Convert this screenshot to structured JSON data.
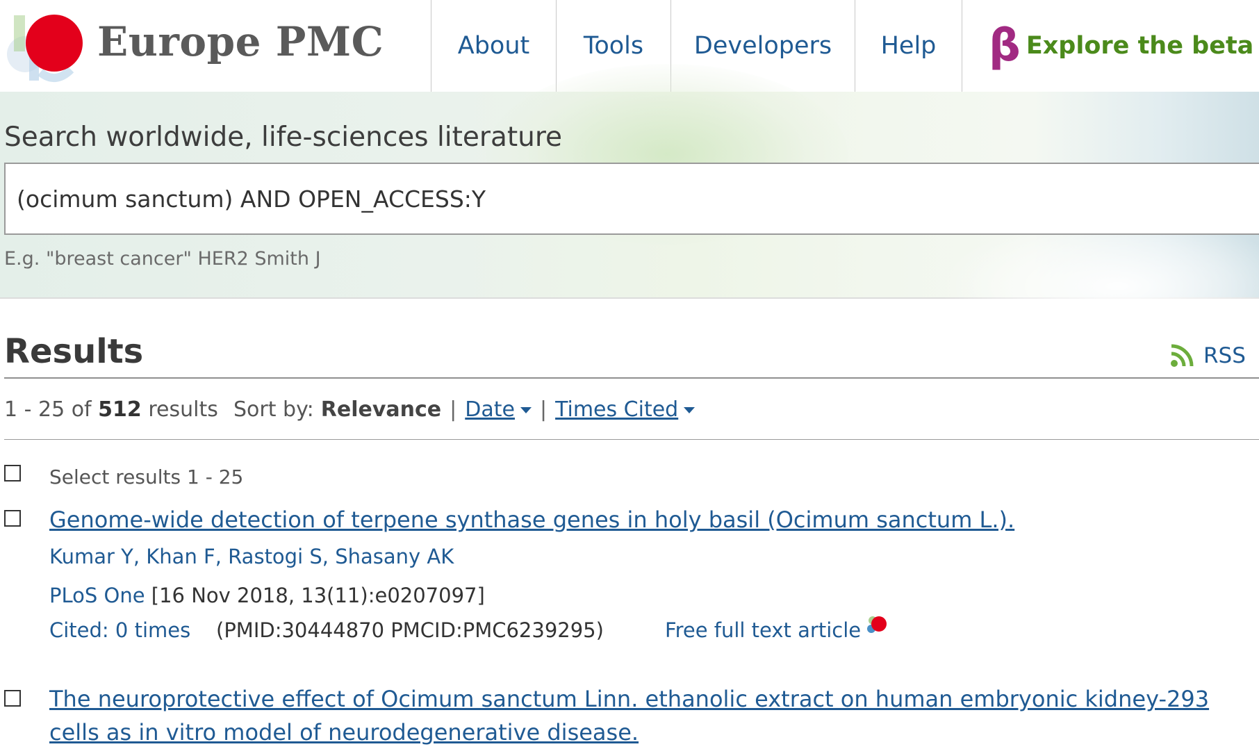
{
  "header": {
    "logo_text": "Europe PMC",
    "nav": {
      "about": "About",
      "tools": "Tools",
      "developers": "Developers",
      "help": "Help",
      "beta_symbol": "β",
      "beta_label": "Explore the beta version"
    }
  },
  "search": {
    "label": "Search worldwide, life-sciences literature",
    "query": "(ocimum sanctum) AND OPEN_ACCESS:Y",
    "hint": "E.g. \"breast cancer\" HER2 Smith J"
  },
  "results": {
    "title": "Results",
    "rss_label": "RSS",
    "summary_range": "1 - 25 of",
    "summary_total": "512",
    "summary_suffix": "results",
    "sort": {
      "prefix": "Sort by:",
      "active": "Relevance",
      "separator": "|",
      "date": "Date",
      "times_cited": "Times Cited"
    },
    "select_label": "Select results 1 - 25",
    "items": [
      {
        "title": "Genome-wide detection of terpene synthase genes in holy basil (Ocimum sanctum L.).",
        "authors": [
          "Kumar Y",
          "Khan F",
          "Rastogi S",
          "Shasany AK"
        ],
        "journal": "PLoS One",
        "citation": "[16 Nov 2018, 13(11):e0207097]",
        "cited": "Cited: 0 times",
        "ids": "(PMID:30444870 PMCID:PMC6239295)",
        "free_full_text": "Free full text article"
      },
      {
        "title": "The neuroprotective effect of Ocimum sanctum Linn. ethanolic extract on human embryonic kidney-293 cells as in vitro model of neurodegenerative disease."
      }
    ]
  },
  "colors": {
    "link": "#1f5a93",
    "beta_green": "#4b8a1b",
    "beta_symbol": "#a12a82",
    "rss_green": "#6cad3c",
    "logo_red": "#e3001b"
  }
}
